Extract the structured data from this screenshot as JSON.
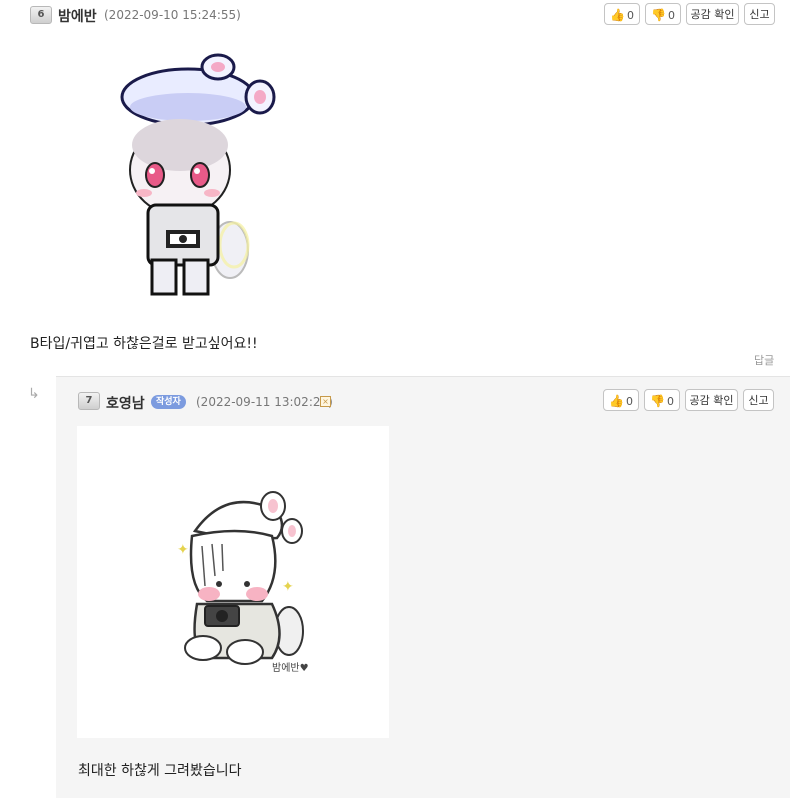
{
  "comment": {
    "level": "6",
    "nickname": "밤에반",
    "date": "(2022-09-10 15:24:55)",
    "text": "B타입/귀엽고 하찮은걸로 받고싶어요!!",
    "reply_label": "답글",
    "image_alt": "pixel-art-character"
  },
  "actions": {
    "like_count": "0",
    "dislike_count": "0",
    "empathy_label": "공감 확인",
    "report_label": "신고"
  },
  "reply": {
    "arrow": "↳",
    "level": "7",
    "nickname": "호영남",
    "badge": "작성자",
    "date": "(2022-09-11 13:02:20)",
    "delete_mark": "×",
    "text": "최대한 하찮게 그려봤습니다",
    "drawing_signature": "밤에반♥"
  },
  "colors": {
    "like": "#e35b5b",
    "dislike": "#4f78d1",
    "badge": "#7c9bdf",
    "reply_bg": "#f5f5f5"
  }
}
